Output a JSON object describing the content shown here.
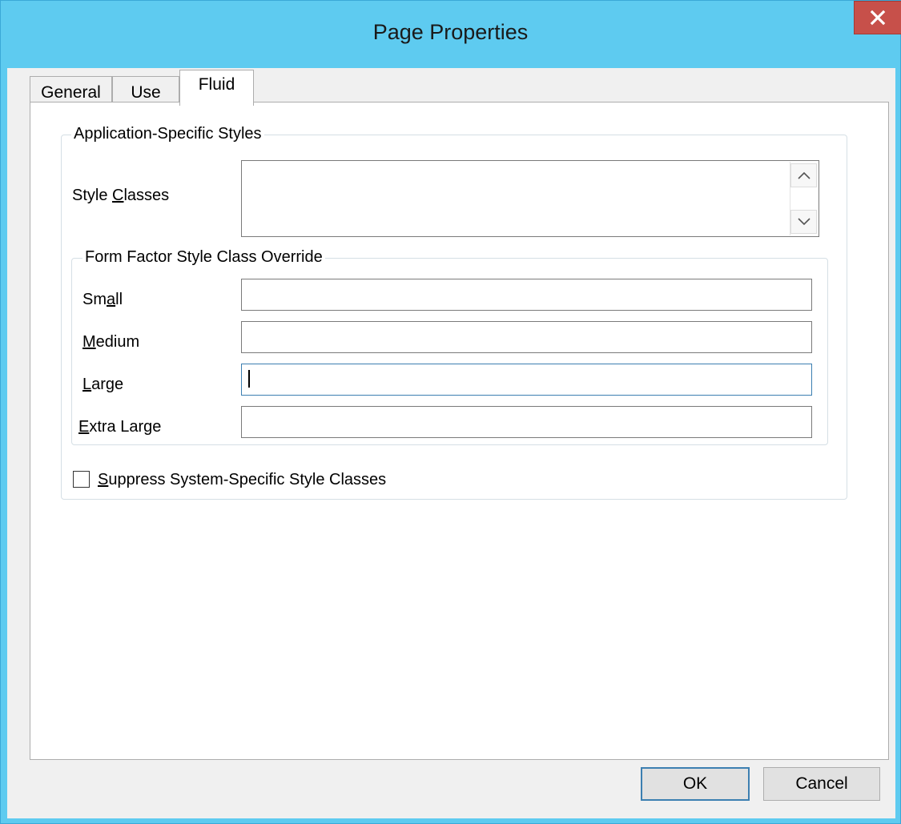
{
  "window": {
    "title": "Page Properties",
    "close_glyph": "✕"
  },
  "tabs": [
    {
      "label": "General"
    },
    {
      "label": "Use"
    },
    {
      "label": "Fluid"
    }
  ],
  "app_styles": {
    "group_label": "Application-Specific Styles",
    "style_classes": {
      "label_prefix": "Style ",
      "label_key": "C",
      "label_suffix": "lasses",
      "value": ""
    }
  },
  "form_factor": {
    "group_label": "Form Factor Style Class Override",
    "small": {
      "label_prefix": "Sm",
      "label_key": "a",
      "label_suffix": "ll",
      "value": ""
    },
    "medium": {
      "label_prefix": "",
      "label_key": "M",
      "label_suffix": "edium",
      "value": ""
    },
    "large": {
      "label_prefix": "",
      "label_key": "L",
      "label_suffix": "arge",
      "value": ""
    },
    "xlarge": {
      "label_prefix": "",
      "label_key": "E",
      "label_suffix": "xtra Large",
      "value": ""
    }
  },
  "suppress": {
    "label_key": "S",
    "label_suffix": "uppress System-Specific Style Classes",
    "checked": false
  },
  "buttons": {
    "ok": "OK",
    "cancel": "Cancel"
  },
  "colors": {
    "titlebar": "#5ecbf0",
    "close": "#c7504a",
    "focus": "#3c7fb1"
  },
  "icons": [
    "close-icon",
    "scroll-up-icon",
    "scroll-down-icon"
  ]
}
